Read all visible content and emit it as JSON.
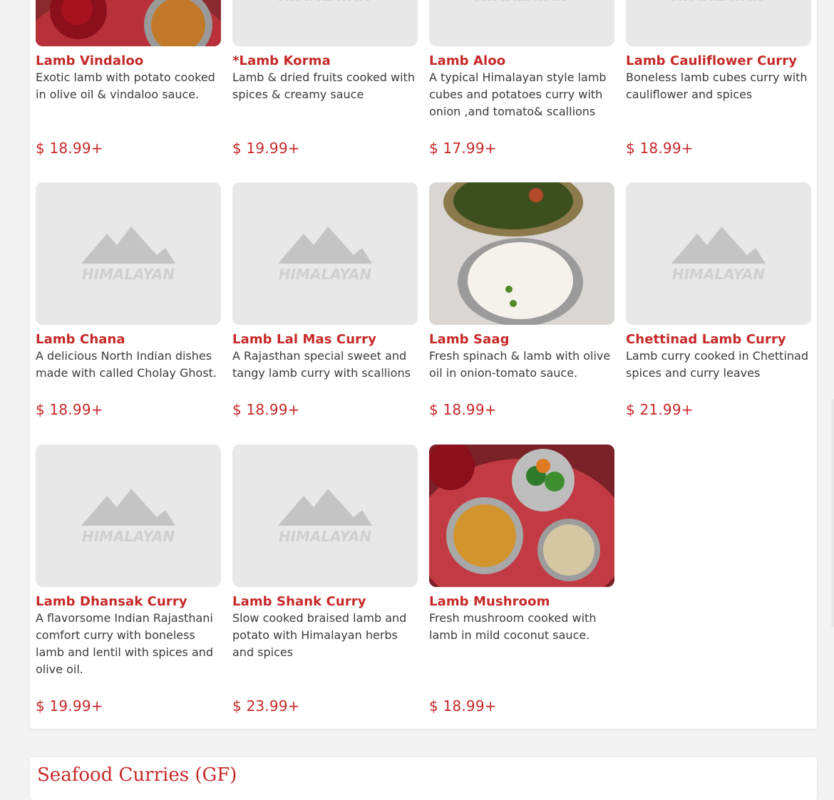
{
  "currency": "$",
  "items": [
    {
      "title": "Lamb Vindaloo",
      "desc": "Exotic lamb with potato cooked in olive oil & vindaloo sauce.",
      "price": "18.99+",
      "image": "photo-curry-rose"
    },
    {
      "title": "*Lamb Korma",
      "desc": "Lamb & dried fruits cooked with spices & creamy sauce",
      "price": "19.99+",
      "image": "himalayan-placeholder"
    },
    {
      "title": "Lamb Aloo",
      "desc": "A typical Himalayan style lamb cubes and potatoes curry with onion ,and tomato& scallions",
      "price": "17.99+",
      "image": "himalayan-placeholder"
    },
    {
      "title": "Lamb Cauliflower Curry",
      "desc": "Boneless lamb cubes curry with cauliflower and spices",
      "price": "18.99+",
      "image": "himalayan-placeholder"
    },
    {
      "title": "Lamb Chana",
      "desc": "A delicious North Indian dishes made with called Cholay Ghost.",
      "price": "18.99+",
      "image": "himalayan-placeholder"
    },
    {
      "title": "Lamb Lal Mas Curry",
      "desc": "A Rajasthan special sweet and tangy lamb curry with scallions",
      "price": "18.99+",
      "image": "himalayan-placeholder"
    },
    {
      "title": "Lamb Saag",
      "desc": "Fresh spinach & lamb with olive oil in onion-tomato sauce.",
      "price": "18.99+",
      "image": "photo-saag-rice"
    },
    {
      "title": "Chettinad Lamb Curry",
      "desc": "Lamb curry cooked in Chettinad spices and curry leaves",
      "price": "21.99+",
      "image": "himalayan-placeholder"
    },
    {
      "title": "Lamb Dhansak Curry",
      "desc": "A flavorsome Indian Rajasthani comfort curry with boneless lamb and lentil with spices and olive oil.",
      "price": "19.99+",
      "image": "himalayan-placeholder"
    },
    {
      "title": "Lamb Shank Curry",
      "desc": "Slow cooked braised lamb and potato with Himalayan herbs and spices",
      "price": "23.99+",
      "image": "himalayan-placeholder"
    },
    {
      "title": "Lamb Mushroom",
      "desc": "Fresh mushroom cooked with lamb in mild coconut sauce.",
      "price": "18.99+",
      "image": "photo-curry-broccoli-rice"
    }
  ],
  "next_section": {
    "title": "Seafood Curries (GF)"
  },
  "placeholder_logo_text": "HIMALAYAN",
  "colors": {
    "accent": "#c62828",
    "text": "#3a3a3a",
    "image_bg": "#e8e8e8"
  }
}
